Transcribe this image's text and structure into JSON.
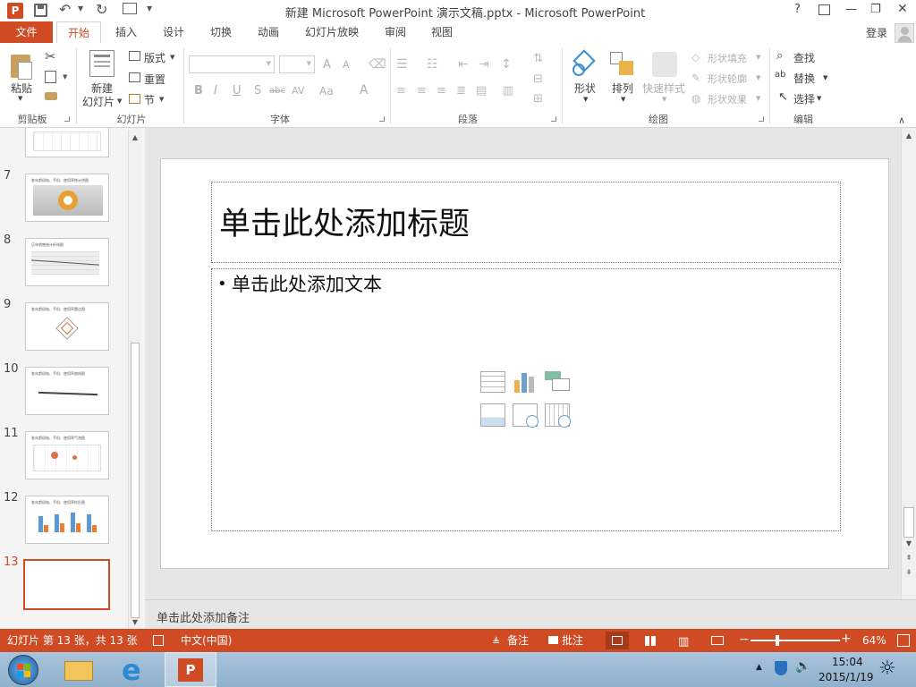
{
  "window": {
    "title": "新建 Microsoft PowerPoint 演示文稿.pptx - Microsoft PowerPoint",
    "help": "?",
    "min": "—",
    "restore": "❐",
    "close": "✕"
  },
  "quick_access": {
    "app_badge": "P"
  },
  "tabs": [
    {
      "label": "文件"
    },
    {
      "label": "开始"
    },
    {
      "label": "插入"
    },
    {
      "label": "设计"
    },
    {
      "label": "切换"
    },
    {
      "label": "动画"
    },
    {
      "label": "幻灯片放映"
    },
    {
      "label": "审阅"
    },
    {
      "label": "视图"
    }
  ],
  "login": "登录",
  "ribbon": {
    "clipboard": {
      "paste": "粘贴",
      "label": "剪贴板"
    },
    "slides": {
      "new_slide_1": "新建",
      "new_slide_2": "幻灯片",
      "layout": "版式",
      "reset": "重置",
      "section": "节",
      "label": "幻灯片"
    },
    "font": {
      "label": "字体",
      "bold": "B",
      "italic": "I",
      "underline": "U",
      "shadow": "S",
      "strike": "abc",
      "spacing": "AV",
      "case": "Aa",
      "color": "A",
      "grow": "A",
      "shrink": "A"
    },
    "paragraph": {
      "label": "段落"
    },
    "drawing": {
      "shapes": "形状",
      "arrange": "排列",
      "quick_styles": "快速样式",
      "fill": "形状填充",
      "outline": "形状轮廓",
      "effects": "形状效果",
      "label": "绘图"
    },
    "editing": {
      "find": "查找",
      "replace": "替换",
      "select": "选择",
      "label": "编辑"
    }
  },
  "thumbnails": [
    {
      "num": "7",
      "caption": "各年龄段电、手机、使用率统计饼图"
    },
    {
      "num": "8",
      "caption": "历年销售统计折线图"
    },
    {
      "num": "9",
      "caption": "各年龄段电、手机、使用率雷达图"
    },
    {
      "num": "10",
      "caption": "各年龄段电、手机、使用率曲线图"
    },
    {
      "num": "11",
      "caption": "各年龄段电、手机、使用率气泡图"
    },
    {
      "num": "12",
      "caption": "各年龄段电、手机、使用率柱形图"
    },
    {
      "num": "13",
      "caption": ""
    }
  ],
  "slide": {
    "title_placeholder": "单击此处添加标题",
    "text_placeholder": "单击此处添加文本",
    "bullet": "•"
  },
  "notes_placeholder": "单击此处添加备注",
  "status": {
    "slide_info": "幻灯片 第 13 张，共 13 张",
    "language": "中文(中国)",
    "notes": "备注",
    "comments": "批注",
    "zoom": "64%",
    "zoom_fraction": 0.64
  },
  "taskbar": {
    "time": "15:04",
    "date": "2015/1/19"
  },
  "colors": {
    "accent": "#d04a24",
    "thumb_selected_border": "#d04a24"
  }
}
